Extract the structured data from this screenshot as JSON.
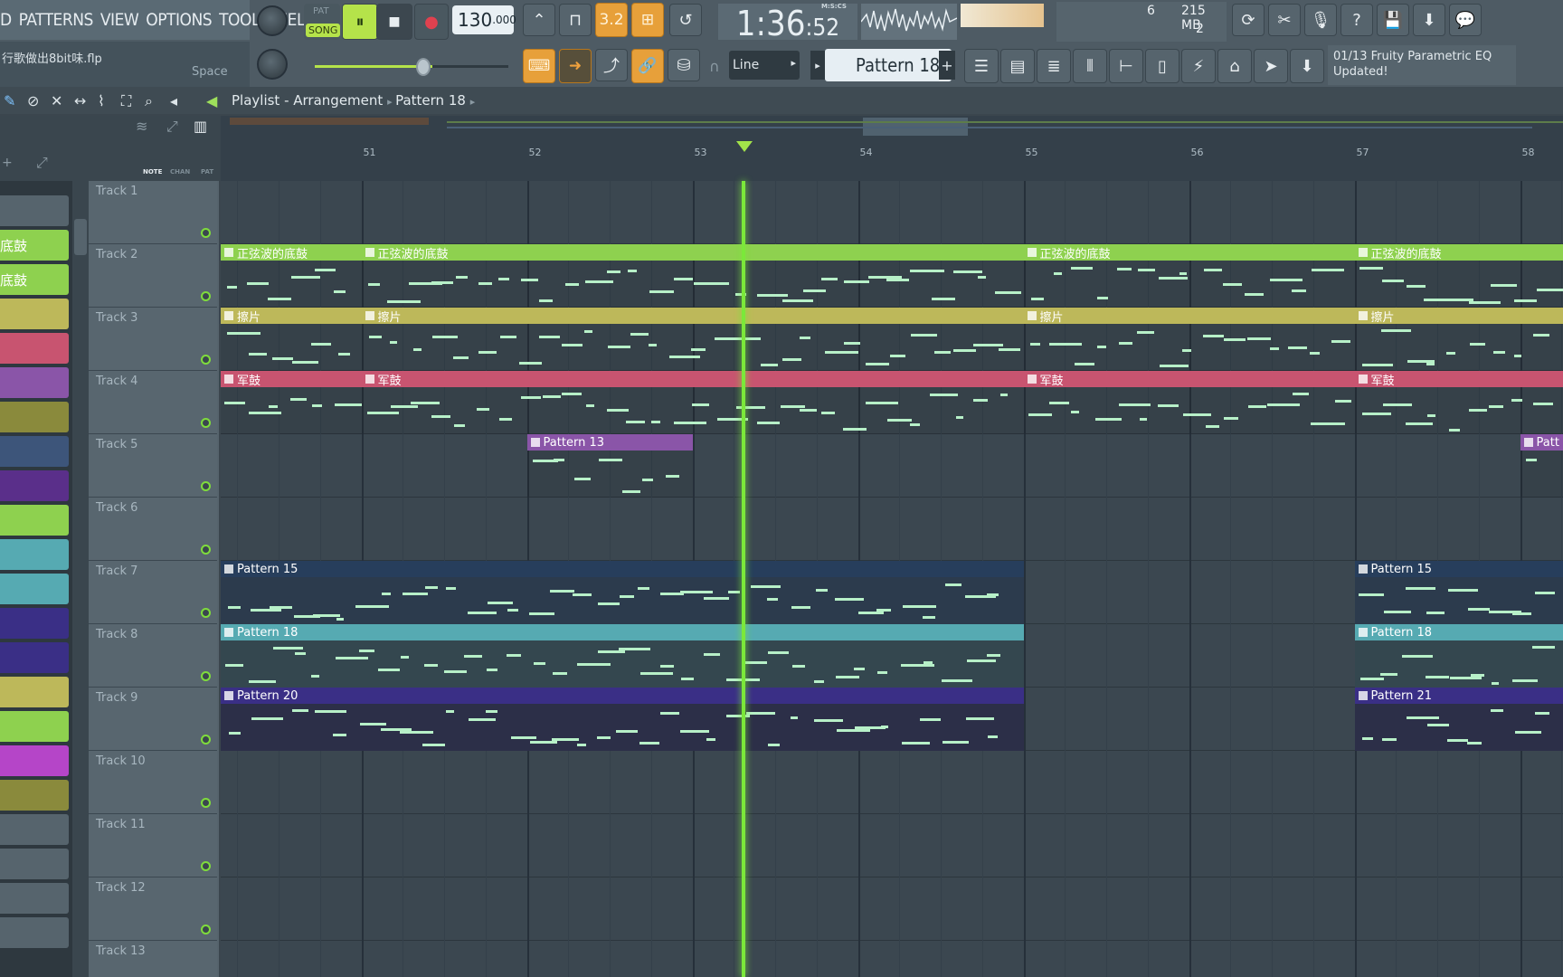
{
  "menu": {
    "items": [
      "D",
      "PATTERNS",
      "VIEW",
      "OPTIONS",
      "TOOLS",
      "HELP"
    ]
  },
  "file": {
    "name": "行歌做出8bit味.flp",
    "space_label": "Space"
  },
  "transport": {
    "pat_label": "PAT",
    "song_label": "SONG",
    "tempo_main": "130",
    "tempo_frac": ".000",
    "time_main": "1:36",
    "time_sub": ":52",
    "time_format": "M:S:CS"
  },
  "memory": {
    "voices": "6",
    "ram": "215 MB",
    "cpu": "2"
  },
  "snap": {
    "mode": "Line"
  },
  "pattern_selector": {
    "current": "Pattern 18"
  },
  "hint_panel": {
    "line1": "01/13  Fruity Parametric EQ",
    "line2": "Updated!"
  },
  "playlist": {
    "title": "Playlist - Arrangement",
    "pattern": "Pattern 18",
    "view_labels": {
      "note": "NOTE",
      "chan": "CHAN",
      "pat": "PAT"
    },
    "ruler_bars": [
      "51",
      "52",
      "53",
      "54",
      "55",
      "56",
      "57",
      "58"
    ],
    "tracks": [
      "Track 1",
      "Track 2",
      "Track 3",
      "Track 4",
      "Track 5",
      "Track 6",
      "Track 7",
      "Track 8",
      "Track 9",
      "Track 10",
      "Track 11",
      "Track 12",
      "Track 13"
    ],
    "clip_names": {
      "sine_bass": "正弦波的底鼓",
      "cymbal": "擦片",
      "snare": "军鼓",
      "p13": "Pattern 13",
      "p15": "Pattern 15",
      "p18": "Pattern 18",
      "p20": "Pattern 20",
      "p21": "Pattern 21",
      "patt_cut": "Patt"
    }
  },
  "channels": {
    "labels": [
      "底鼓",
      "底鼓"
    ]
  },
  "colors": {
    "green": "#8ed14f",
    "yellow": "#bdb85a",
    "pink": "#c85470",
    "purple": "#8a55a8",
    "navy": "#273e5c",
    "teal": "#56aab2",
    "indigo": "#3a2f86",
    "playhead": "#7be83a"
  }
}
